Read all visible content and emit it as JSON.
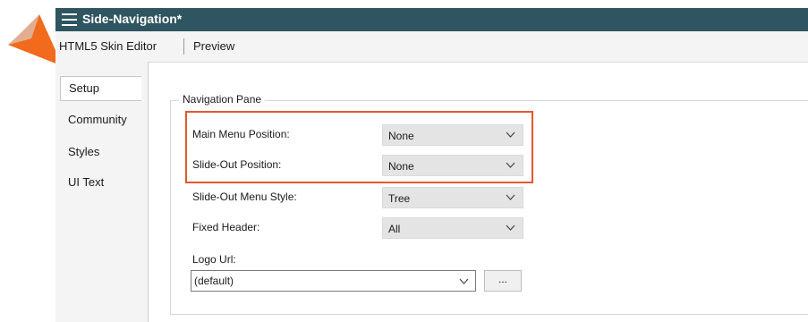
{
  "window": {
    "title": "Side-Navigation*"
  },
  "editor_tabs": [
    "HTML5 Skin Editor",
    "Preview"
  ],
  "sidebar": {
    "items": [
      {
        "label": "Setup",
        "active": true
      },
      {
        "label": "Community"
      },
      {
        "label": "Styles"
      },
      {
        "label": "UI Text"
      }
    ]
  },
  "navigation_pane": {
    "title": "Navigation Pane",
    "fields": [
      {
        "label": "Main Menu Position:",
        "value": "None"
      },
      {
        "label": "Slide-Out Position:",
        "value": "None"
      },
      {
        "label": "Slide-Out Menu Style:",
        "value": "Tree"
      },
      {
        "label": "Fixed Header:",
        "value": "All"
      }
    ],
    "logo_url": {
      "label": "Logo Url:",
      "value": "(default)",
      "browse_label": "..."
    }
  },
  "colors": {
    "titlebar": "#2e5560",
    "highlight": "#e4572e",
    "callout": "#f26a1b"
  },
  "icons": [
    "hamburger-icon",
    "chevron-down-icon",
    "callout-arrow-icon"
  ]
}
